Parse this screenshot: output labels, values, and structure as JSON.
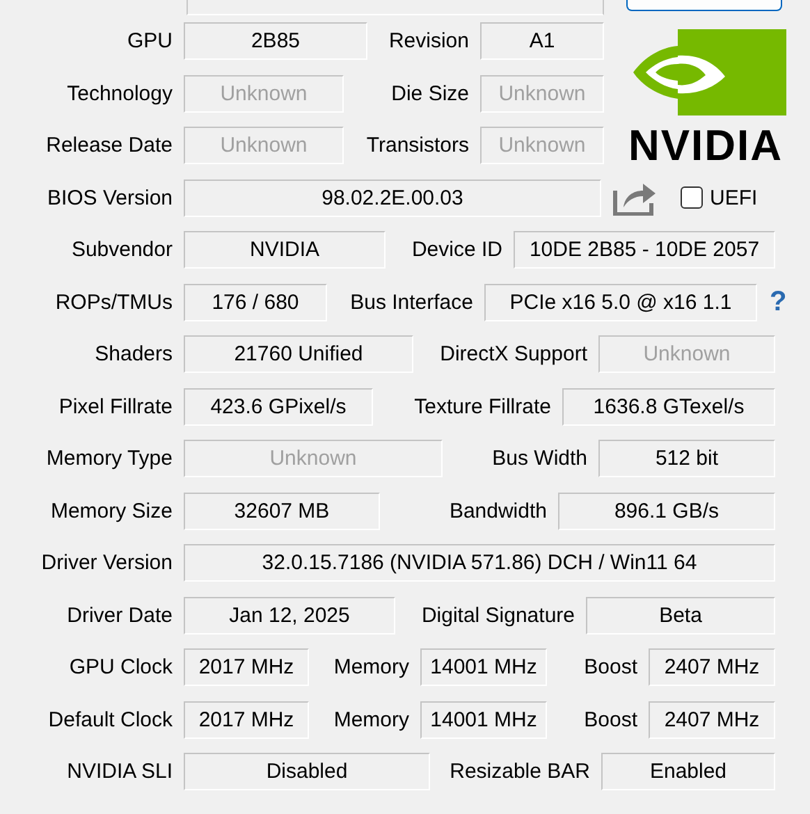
{
  "rows": [
    {
      "cells": [
        {
          "kind": "label",
          "text": "GPU"
        },
        {
          "kind": "field",
          "text": "2B85",
          "disabled": false
        },
        {
          "kind": "label",
          "text": "Revision"
        },
        {
          "kind": "field",
          "text": "A1",
          "disabled": false
        }
      ]
    },
    {
      "cells": [
        {
          "kind": "label",
          "text": "Technology"
        },
        {
          "kind": "field",
          "text": "Unknown",
          "disabled": true
        },
        {
          "kind": "label",
          "text": "Die Size"
        },
        {
          "kind": "field",
          "text": "Unknown",
          "disabled": true
        }
      ]
    },
    {
      "cells": [
        {
          "kind": "label",
          "text": "Release Date"
        },
        {
          "kind": "field",
          "text": "Unknown",
          "disabled": true
        },
        {
          "kind": "label",
          "text": "Transistors"
        },
        {
          "kind": "field",
          "text": "Unknown",
          "disabled": true
        }
      ]
    },
    {
      "cells": [
        {
          "kind": "label",
          "text": "BIOS Version"
        },
        {
          "kind": "field",
          "text": "98.02.2E.00.03",
          "disabled": false
        },
        {
          "kind": "share"
        },
        {
          "kind": "checkbox",
          "text": "UEFI",
          "checked": false
        }
      ]
    },
    {
      "cells": [
        {
          "kind": "label",
          "text": "Subvendor"
        },
        {
          "kind": "field",
          "text": "NVIDIA",
          "disabled": false
        },
        {
          "kind": "label",
          "text": "Device ID"
        },
        {
          "kind": "field",
          "text": "10DE 2B85 - 10DE 2057",
          "disabled": false
        }
      ]
    },
    {
      "cells": [
        {
          "kind": "label",
          "text": "ROPs/TMUs"
        },
        {
          "kind": "field",
          "text": "176 / 680",
          "disabled": false
        },
        {
          "kind": "label",
          "text": "Bus Interface"
        },
        {
          "kind": "field",
          "text": "PCIe x16 5.0 @ x16 1.1",
          "disabled": false
        },
        {
          "kind": "help",
          "text": "?"
        }
      ]
    },
    {
      "cells": [
        {
          "kind": "label",
          "text": "Shaders"
        },
        {
          "kind": "field",
          "text": "21760 Unified",
          "disabled": false
        },
        {
          "kind": "label",
          "text": "DirectX Support"
        },
        {
          "kind": "field",
          "text": "Unknown",
          "disabled": true
        }
      ]
    },
    {
      "cells": [
        {
          "kind": "label",
          "text": "Pixel Fillrate"
        },
        {
          "kind": "field",
          "text": "423.6 GPixel/s",
          "disabled": false
        },
        {
          "kind": "label",
          "text": "Texture Fillrate"
        },
        {
          "kind": "field",
          "text": "1636.8 GTexel/s",
          "disabled": false
        }
      ]
    },
    {
      "cells": [
        {
          "kind": "label",
          "text": "Memory Type"
        },
        {
          "kind": "field",
          "text": "Unknown",
          "disabled": true
        },
        {
          "kind": "label",
          "text": "Bus Width"
        },
        {
          "kind": "field",
          "text": "512 bit",
          "disabled": false
        }
      ]
    },
    {
      "cells": [
        {
          "kind": "label",
          "text": "Memory Size"
        },
        {
          "kind": "field",
          "text": "32607 MB",
          "disabled": false
        },
        {
          "kind": "label",
          "text": "Bandwidth"
        },
        {
          "kind": "field",
          "text": "896.1 GB/s",
          "disabled": false
        }
      ]
    },
    {
      "cells": [
        {
          "kind": "label",
          "text": "Driver Version"
        },
        {
          "kind": "field",
          "text": "32.0.15.7186 (NVIDIA 571.86) DCH / Win11 64",
          "disabled": false
        }
      ]
    },
    {
      "cells": [
        {
          "kind": "label",
          "text": "Driver Date"
        },
        {
          "kind": "field",
          "text": "Jan 12, 2025",
          "disabled": false
        },
        {
          "kind": "label",
          "text": "Digital Signature"
        },
        {
          "kind": "field",
          "text": "Beta",
          "disabled": false
        }
      ]
    },
    {
      "cells": [
        {
          "kind": "label",
          "text": "GPU Clock"
        },
        {
          "kind": "field",
          "text": "2017 MHz",
          "disabled": false
        },
        {
          "kind": "label",
          "text": "Memory"
        },
        {
          "kind": "field",
          "text": "14001 MHz",
          "disabled": false
        },
        {
          "kind": "label",
          "text": "Boost"
        },
        {
          "kind": "field",
          "text": "2407 MHz",
          "disabled": false
        }
      ]
    },
    {
      "cells": [
        {
          "kind": "label",
          "text": "Default Clock"
        },
        {
          "kind": "field",
          "text": "2017 MHz",
          "disabled": false
        },
        {
          "kind": "label",
          "text": "Memory"
        },
        {
          "kind": "field",
          "text": "14001 MHz",
          "disabled": false
        },
        {
          "kind": "label",
          "text": "Boost"
        },
        {
          "kind": "field",
          "text": "2407 MHz",
          "disabled": false
        }
      ]
    },
    {
      "cells": [
        {
          "kind": "label",
          "text": "NVIDIA SLI"
        },
        {
          "kind": "field",
          "text": "Disabled",
          "disabled": false
        },
        {
          "kind": "label",
          "text": "Resizable BAR"
        },
        {
          "kind": "field",
          "text": "Enabled",
          "disabled": false
        }
      ]
    }
  ],
  "logo": {
    "text": "NVIDIA"
  }
}
